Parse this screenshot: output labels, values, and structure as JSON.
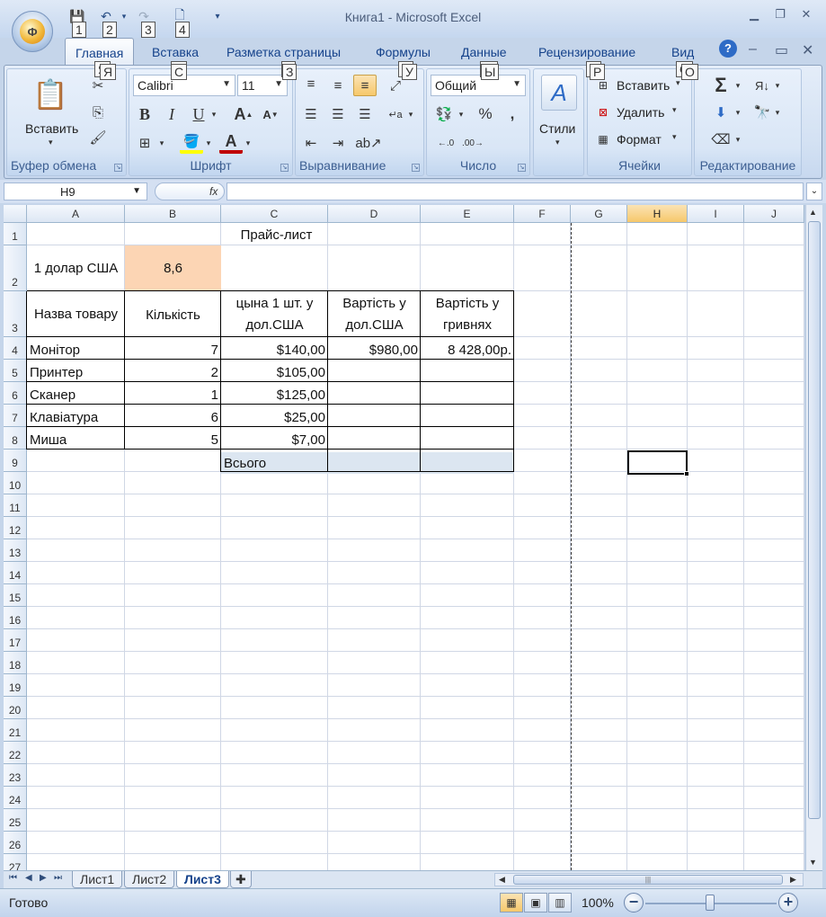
{
  "window": {
    "title": "Книга1 - Microsoft Excel",
    "office_button_letter": "Ф"
  },
  "qat": {
    "keytips": [
      "1",
      "2",
      "3",
      "4"
    ]
  },
  "tabs": [
    {
      "label": "Главная",
      "keytip": "Я"
    },
    {
      "label": "Вставка",
      "keytip": "С"
    },
    {
      "label": "Разметка страницы",
      "keytip": "З"
    },
    {
      "label": "Формулы",
      "keytip": "У"
    },
    {
      "label": "Данные",
      "keytip": "Ы"
    },
    {
      "label": "Рецензирование",
      "keytip": "Р"
    },
    {
      "label": "Вид",
      "keytip": "О"
    }
  ],
  "ribbon": {
    "clipboard": {
      "label": "Буфер обмена",
      "paste": "Вставить"
    },
    "font": {
      "label": "Шрифт",
      "name": "Calibri",
      "size": "11"
    },
    "alignment": {
      "label": "Выравнивание"
    },
    "number": {
      "label": "Число",
      "format": "Общий",
      "percent": "%",
      "comma": ","
    },
    "styles": {
      "label": "Стили"
    },
    "cells": {
      "label": "Ячейки",
      "insert": "Вставить",
      "delete": "Удалить",
      "format": "Формат"
    },
    "editing": {
      "label": "Редактирование"
    }
  },
  "formula_bar": {
    "name_box": "H9",
    "fx": "fx",
    "value": ""
  },
  "grid": {
    "columns": [
      "A",
      "B",
      "C",
      "D",
      "E",
      "F",
      "G",
      "H",
      "I",
      "J"
    ],
    "selected_column": "H",
    "rows": [
      "1",
      "2",
      "3",
      "4",
      "5",
      "6",
      "7",
      "8",
      "9",
      "10",
      "11",
      "12",
      "13",
      "14",
      "15",
      "16",
      "17",
      "18",
      "19",
      "20",
      "21",
      "22",
      "23",
      "24",
      "25",
      "26",
      "27"
    ],
    "selected_cell": "H9",
    "cells": {
      "c1": "Прайс-лист",
      "a2": "1 долар США",
      "b2": "8,6",
      "a3": "Назва товару",
      "b3": "Кількість",
      "c3": "цына 1 шт. у дол.США",
      "d3": "Вартість у дол.США",
      "e3": "Вартість у гривнях",
      "a4": "Монітор",
      "b4": "7",
      "c4": "$140,00",
      "d4": "$980,00",
      "e4": "8 428,00р.",
      "a5": "Принтер",
      "b5": "2",
      "c5": "$105,00",
      "a6": "Сканер",
      "b6": "1",
      "c6": "$125,00",
      "a7": "Клавіатура",
      "b7": "6",
      "c7": "$25,00",
      "a8": "Миша",
      "b8": "5",
      "c8": "$7,00",
      "c9": "Всього"
    },
    "colors": {
      "rate_cell": "#fcd5b4",
      "total_row": "#dce6f1",
      "selection": "#000000"
    }
  },
  "sheets": {
    "tabs": [
      "Лист1",
      "Лист2",
      "Лист3"
    ],
    "active": "Лист3"
  },
  "status": {
    "ready": "Готово",
    "zoom": "100%"
  }
}
